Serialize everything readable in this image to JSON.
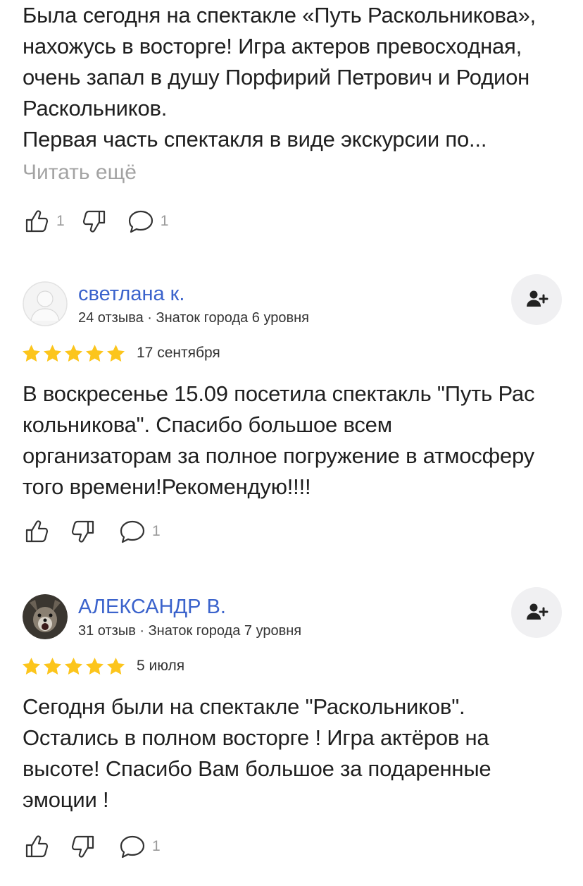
{
  "reviews": [
    {
      "text_lines": [
        "Была сегодня на спектакле «Путь Раскольникова»,",
        "нахожусь в восторге! Игра актеров превосходная,",
        "очень запал в душу Порфирий Петрович и Родион",
        "Раскольников.",
        "Первая часть спектакля в виде экскурсии по..."
      ],
      "read_more": "Читать ещё",
      "likes": "1",
      "comments": "1"
    },
    {
      "author": "светлана к.",
      "meta": "24 отзыва · Знаток города 6 уровня",
      "rating": 5,
      "date": "17 сентября",
      "text_lines": [
        "В воскресенье 15.09 посетила спектакль \"Путь Рас",
        "кольникова\". Спасибо большое всем",
        "организаторам за полное погружение в атмосферу",
        "того времени!Рекомендую!!!!"
      ],
      "comments": "1"
    },
    {
      "author": "АЛЕКСАНДР В.",
      "meta": "31 отзыв · Знаток города 7 уровня",
      "rating": 5,
      "date": "5 июля",
      "text_lines": [
        "Сегодня были на спектакле \"Раскольников\".",
        "Остались в полном восторге ! Игра актёров на",
        "высоте! Спасибо Вам большое за подаренные",
        "эмоции !"
      ],
      "comments": "1"
    }
  ],
  "colors": {
    "author_link": "#3b63cc",
    "star": "#fcc51c",
    "muted": "#9a9a9a",
    "follow_bg": "#f0f0f2"
  },
  "icons": [
    "thumbs-up-icon",
    "thumbs-down-icon",
    "comment-icon",
    "add-user-icon",
    "star-icon",
    "avatar-placeholder-icon"
  ]
}
